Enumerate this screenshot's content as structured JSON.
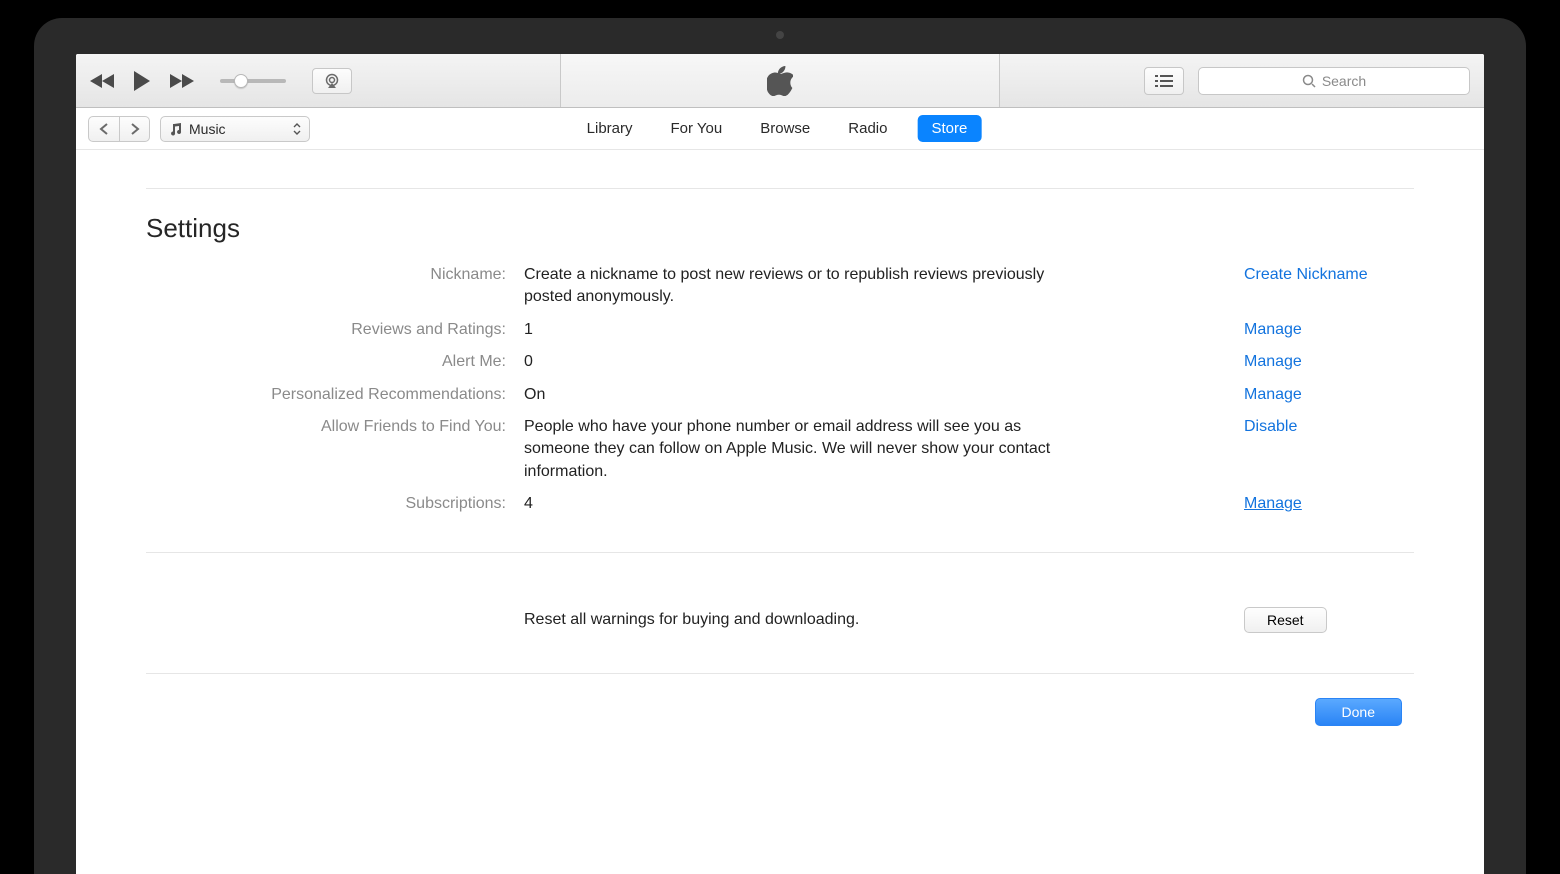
{
  "toolbar": {
    "search_placeholder": "Search",
    "volume_percent": 32
  },
  "secondary": {
    "media_selector_label": "Music",
    "tabs": [
      {
        "label": "Library"
      },
      {
        "label": "For You"
      },
      {
        "label": "Browse"
      },
      {
        "label": "Radio"
      },
      {
        "label": "Store"
      }
    ],
    "active_tab": "Store"
  },
  "settings": {
    "title": "Settings",
    "rows": [
      {
        "label": "Nickname:",
        "value": "Create a nickname to post new reviews or to republish reviews previously posted anonymously.",
        "action": "Create Nickname",
        "underlined": false
      },
      {
        "label": "Reviews and Ratings:",
        "value": "1",
        "action": "Manage",
        "underlined": false
      },
      {
        "label": "Alert Me:",
        "value": "0",
        "action": "Manage",
        "underlined": false
      },
      {
        "label": "Personalized Recommendations:",
        "value": "On",
        "action": "Manage",
        "underlined": false
      },
      {
        "label": "Allow Friends to Find You:",
        "value": "People who have your phone number or email address will see you as someone they can follow on Apple Music. We will never show your contact information.",
        "action": "Disable",
        "underlined": false
      },
      {
        "label": "Subscriptions:",
        "value": "4",
        "action": "Manage",
        "underlined": true
      }
    ],
    "reset": {
      "text": "Reset all warnings for buying and downloading.",
      "button": "Reset"
    },
    "done_button": "Done"
  }
}
